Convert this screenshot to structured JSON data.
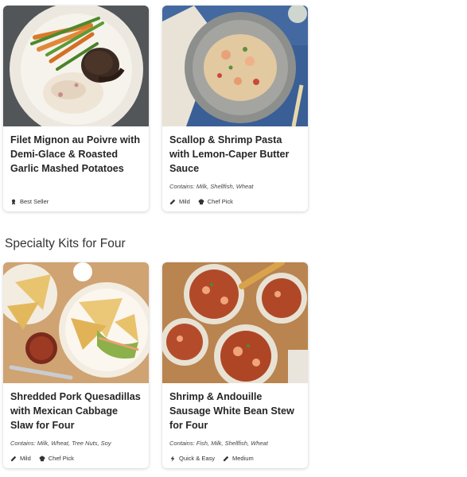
{
  "cards": [
    {
      "title": "Filet Mignon au Poivre with Demi-Glace & Roasted Garlic Mashed Potatoes",
      "contains": "",
      "tags": [
        {
          "icon": "ribbon-icon",
          "label": "Best Seller"
        }
      ]
    },
    {
      "title": "Scallop & Shrimp Pasta with Lemon-Caper Butter Sauce",
      "contains": "Contains: Milk, Shellfish, Wheat",
      "tags": [
        {
          "icon": "pepper-icon",
          "label": "Mild"
        },
        {
          "icon": "chef-hat-icon",
          "label": "Chef Pick"
        }
      ]
    },
    {
      "title": "Shredded Pork Quesadillas with Mexican Cabbage Slaw for Four",
      "contains": "Contains: Milk, Wheat, Tree Nuts, Soy",
      "tags": [
        {
          "icon": "pepper-icon",
          "label": "Mild"
        },
        {
          "icon": "chef-hat-icon",
          "label": "Chef Pick"
        }
      ]
    },
    {
      "title": "Shrimp & Andouille Sausage White Bean Stew for Four",
      "contains": "Contains: Fish, Milk, Shellfish, Wheat",
      "tags": [
        {
          "icon": "lightning-icon",
          "label": "Quick & Easy"
        },
        {
          "icon": "pepper-icon",
          "label": "Medium"
        }
      ]
    }
  ],
  "section": {
    "heading": "Specialty Kits for Four"
  }
}
